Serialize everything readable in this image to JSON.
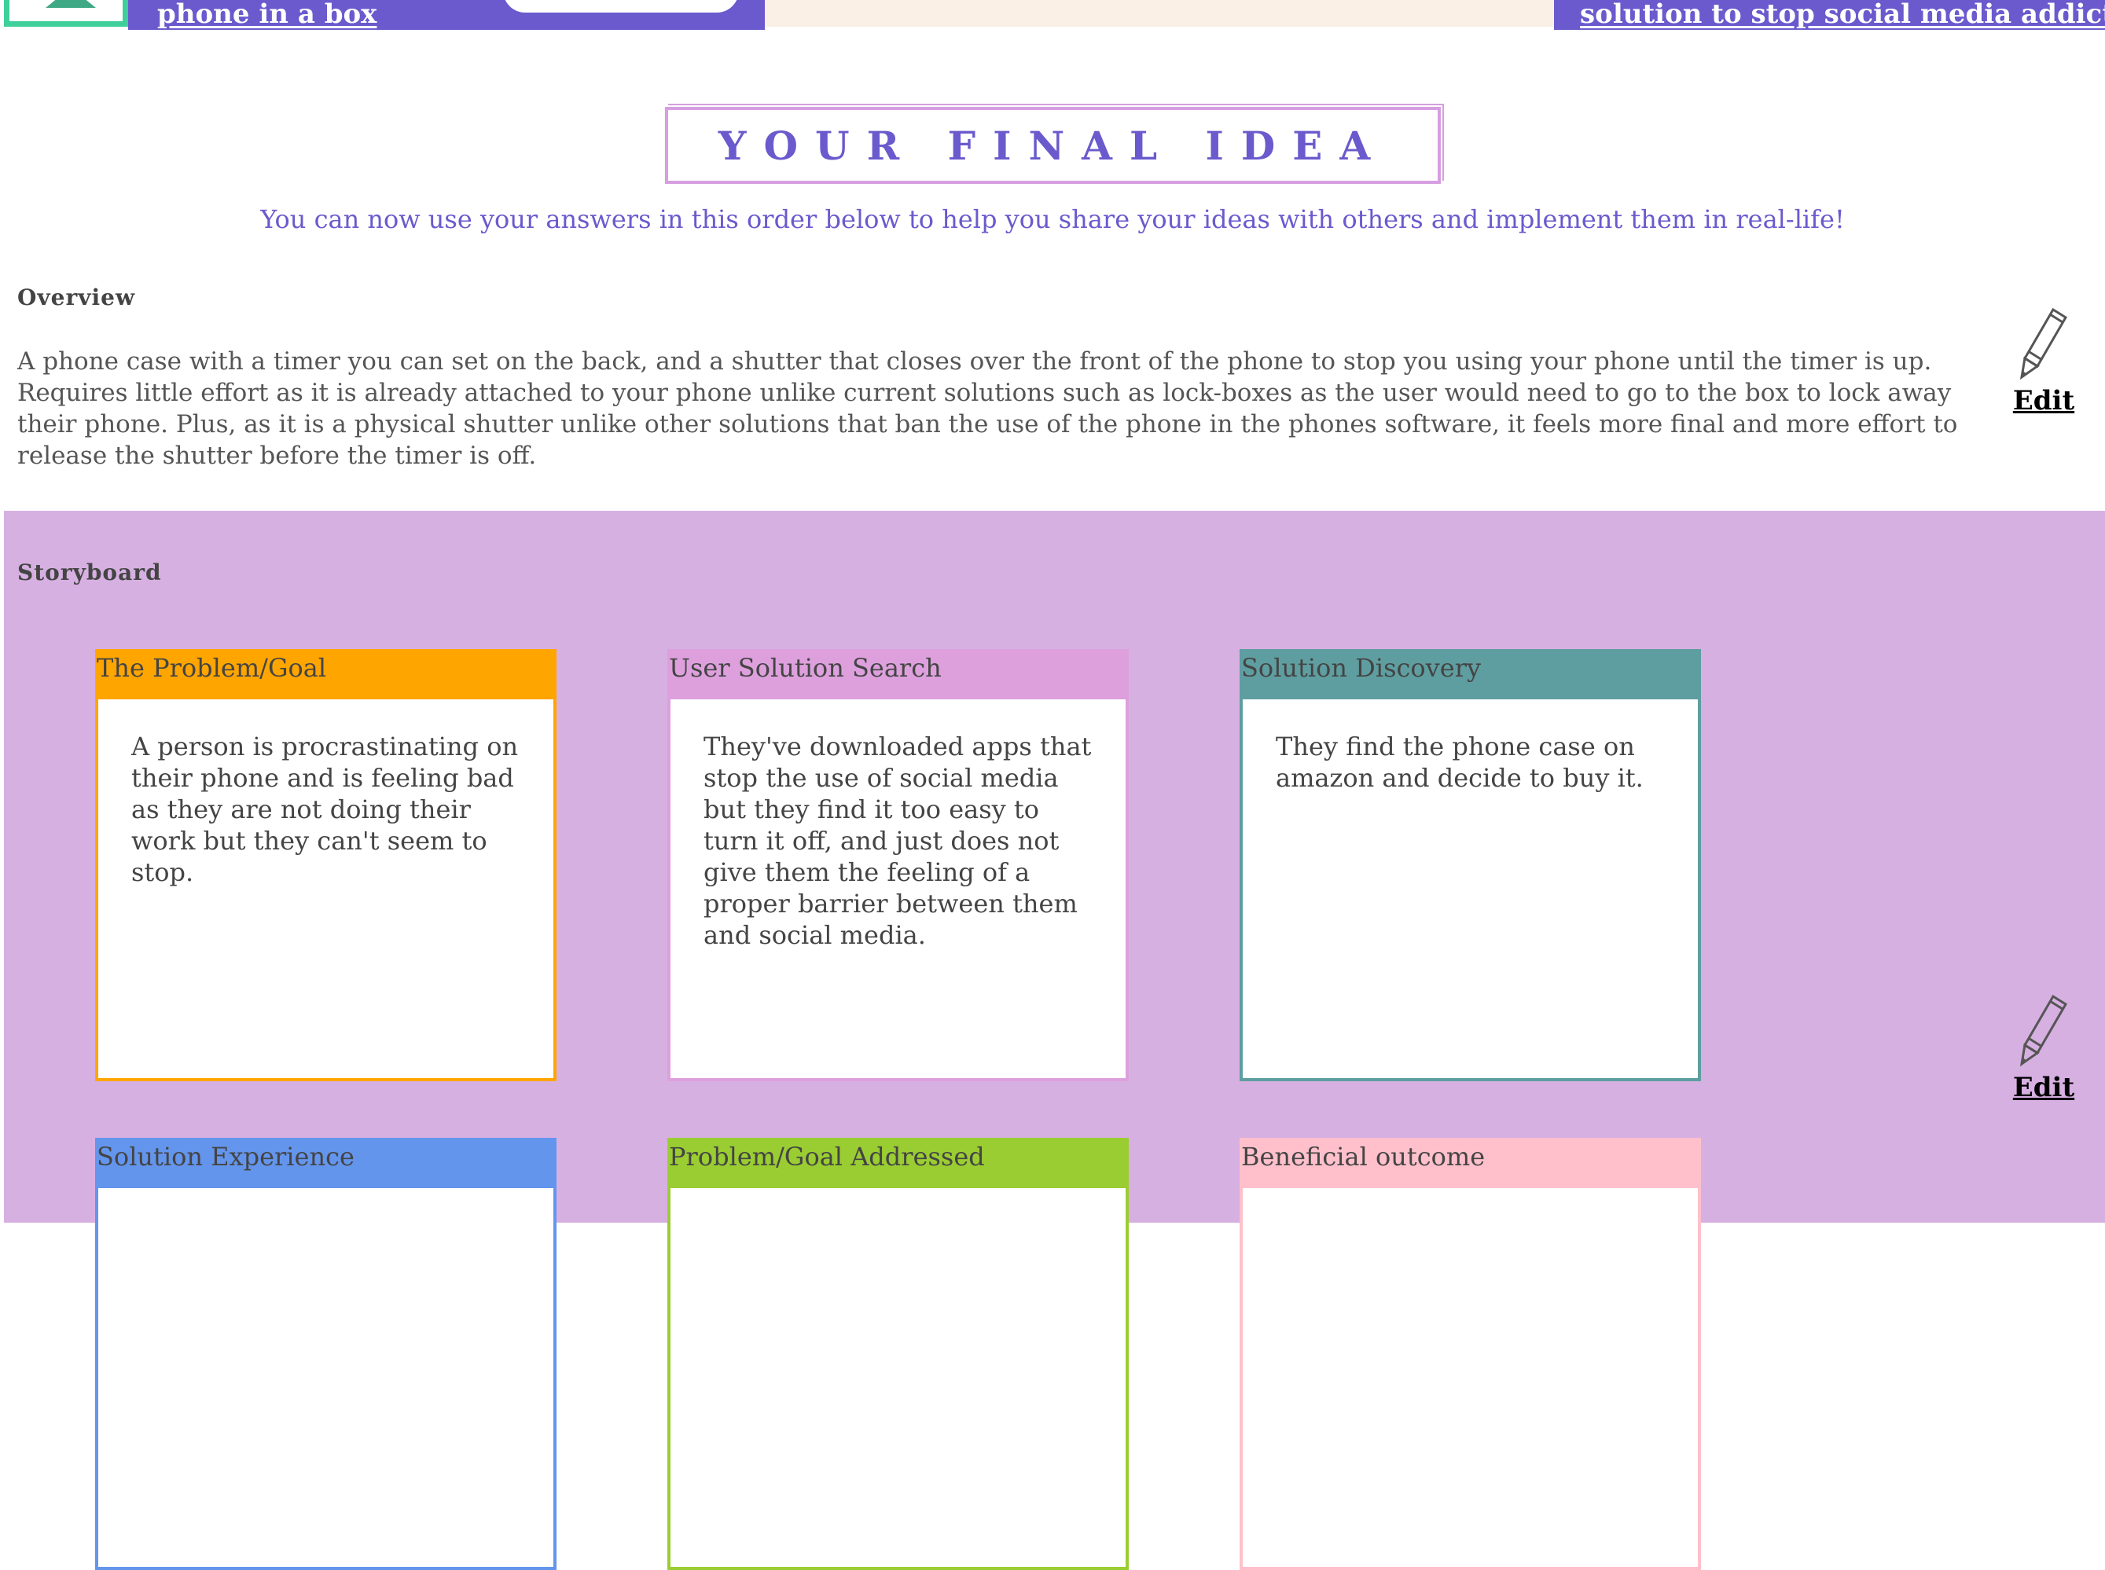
{
  "top_bar": {
    "title": "phone in a box",
    "description": "solution to stop social media addiction"
  },
  "heading": "YOUR FINAL IDEA",
  "subtitle": "You can now use your answers in this order below to help you share your ideas with others and implement them in real-life!",
  "overview": {
    "label": "Overview",
    "text": "A phone case with a timer you can set on the back, and a shutter that closes over the front of the phone to stop you using your phone until the timer is up. Requires little effort as it is already attached to your phone unlike current solutions such as lock-boxes as the user would need to go to the box to lock away their phone. Plus, as it is a physical shutter unlike other solutions that ban the use of the phone in the phones software, it feels more final and more effort to release the shutter before the timer is off.",
    "edit_label": "Edit"
  },
  "storyboard": {
    "label": "Storyboard",
    "edit_label": "Edit",
    "cards": [
      {
        "title": "The Problem/Goal",
        "text": "A person is procrastinating on their phone and is feeling bad as they are not doing their work but they can't seem to stop.",
        "color": "#ffa500"
      },
      {
        "title": "User Solution Search",
        "text": "They've downloaded apps that stop the use of social media but they find it too easy to turn it off, and just does not give them the feeling of a proper barrier between them and social media.",
        "color": "#dda0dd"
      },
      {
        "title": "Solution Discovery",
        "text": "They find the phone case on amazon and decide to buy it.",
        "color": "#5f9ea0"
      },
      {
        "title": "Solution Experience",
        "text": "",
        "color": "#6495ed"
      },
      {
        "title": "Problem/Goal Addressed",
        "text": "",
        "color": "#9acd32"
      },
      {
        "title": "Beneficial outcome",
        "text": "",
        "color": "#ffc0cb"
      }
    ]
  },
  "colors": {
    "accent_purple": "#6a5acd",
    "storyboard_bg": "#d7b0e2",
    "logo_green": "#3ecf9a"
  },
  "icons": {
    "edit": "pencil-icon"
  }
}
